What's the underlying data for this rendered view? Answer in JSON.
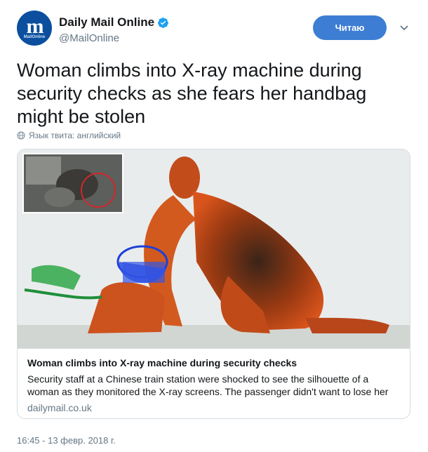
{
  "account": {
    "display_name": "Daily Mail Online",
    "handle": "@MailOnline",
    "avatar_letter": "m",
    "avatar_sub": "MailOnline",
    "verified": true
  },
  "follow_button": {
    "label": "Читаю"
  },
  "tweet": {
    "text": "Woman climbs into X-ray machine during security checks as she fears her handbag might be stolen",
    "language_note": "Язык твита: английский",
    "timestamp": "16:45 - 13 февр. 2018 г."
  },
  "card": {
    "title": "Woman climbs into X-ray machine during security checks",
    "description": "Security staff at a Chinese train station were shocked to see the silhouette of a woman as they monitored the X-ray screens. The passenger didn't want to lose her",
    "domain": "dailymail.co.uk"
  },
  "colors": {
    "accent": "#3d7ed4",
    "brand": "#0b4f9e",
    "muted_text": "#657786",
    "border": "#d6dde3"
  },
  "icons": [
    "verified-badge-icon",
    "chevron-down-icon",
    "globe-icon"
  ]
}
